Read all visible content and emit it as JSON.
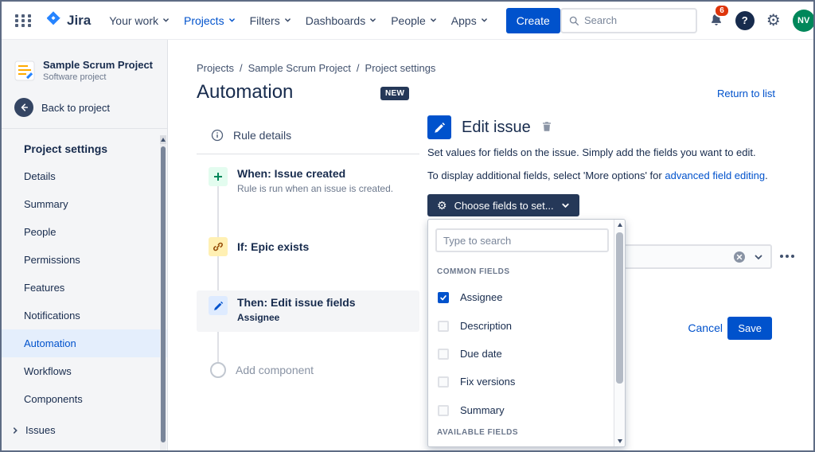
{
  "topbar": {
    "app_name": "Jira",
    "nav": [
      {
        "label": "Your work"
      },
      {
        "label": "Projects"
      },
      {
        "label": "Filters"
      },
      {
        "label": "Dashboards"
      },
      {
        "label": "People"
      },
      {
        "label": "Apps"
      }
    ],
    "create_label": "Create",
    "search_placeholder": "Search",
    "notification_count": "6",
    "help_glyph": "?",
    "avatar_initials": "NV"
  },
  "icons": {
    "gear": "⚙"
  },
  "sidebar": {
    "project_name": "Sample Scrum Project",
    "project_type": "Software project",
    "back_label": "Back to project",
    "section_title": "Project settings",
    "items": [
      {
        "label": "Details"
      },
      {
        "label": "Summary"
      },
      {
        "label": "People"
      },
      {
        "label": "Permissions"
      },
      {
        "label": "Features"
      },
      {
        "label": "Notifications"
      },
      {
        "label": "Automation"
      },
      {
        "label": "Workflows"
      },
      {
        "label": "Components"
      }
    ],
    "issues_label": "Issues"
  },
  "main": {
    "breadcrumb": [
      "Projects",
      "Sample Scrum Project",
      "Project settings"
    ],
    "breadcrumb_separator": "/",
    "title": "Automation",
    "badge": "NEW",
    "return_link": "Return to list",
    "rule": {
      "details_label": "Rule details",
      "steps": [
        {
          "title": "When: Issue created",
          "subtitle": "Rule is run when an issue is created."
        },
        {
          "title": "If: Epic exists"
        },
        {
          "title": "Then: Edit issue fields",
          "subtitle": "Assignee"
        }
      ],
      "add_component": "Add component"
    },
    "editor": {
      "title": "Edit issue",
      "description": "Set values for fields on the issue. Simply add the fields you want to edit.",
      "more_text": "To display additional fields, select 'More options' for",
      "more_link": "advanced field editing",
      "more_suffix": ".",
      "choose_button": "Choose fields to set...",
      "dropdown": {
        "search_placeholder": "Type to search",
        "common_header": "COMMON FIELDS",
        "fields": [
          {
            "label": "Assignee",
            "checked": true
          },
          {
            "label": "Description",
            "checked": false
          },
          {
            "label": "Due date",
            "checked": false
          },
          {
            "label": "Fix versions",
            "checked": false
          },
          {
            "label": "Summary",
            "checked": false
          }
        ],
        "available_header": "AVAILABLE FIELDS"
      },
      "cancel_label": "Cancel",
      "save_label": "Save"
    }
  },
  "colors": {
    "accent": "#0052CC",
    "navy_button": "#253858",
    "notification_red": "#DE350B",
    "avatar_green": "#00875A",
    "sidebar_bg": "#F4F5F7",
    "selected_item_bg": "#E4EEFC"
  }
}
